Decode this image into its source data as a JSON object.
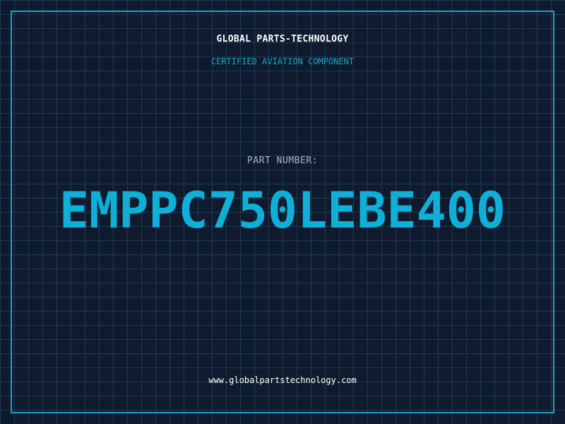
{
  "header": {
    "company": "GLOBAL PARTS-TECHNOLOGY",
    "subtitle": "CERTIFIED AVIATION COMPONENT"
  },
  "part": {
    "label": "PART NUMBER:",
    "number": "EMPPC750LEBE400"
  },
  "footer": {
    "website": "www.globalpartstechnology.com"
  },
  "colors": {
    "background": "#101a2e",
    "grid": "#1c3a52",
    "accent": "#1ba3c6",
    "part_number": "#0fb0d8",
    "label": "#a9b3c2",
    "text": "#ffffff"
  }
}
